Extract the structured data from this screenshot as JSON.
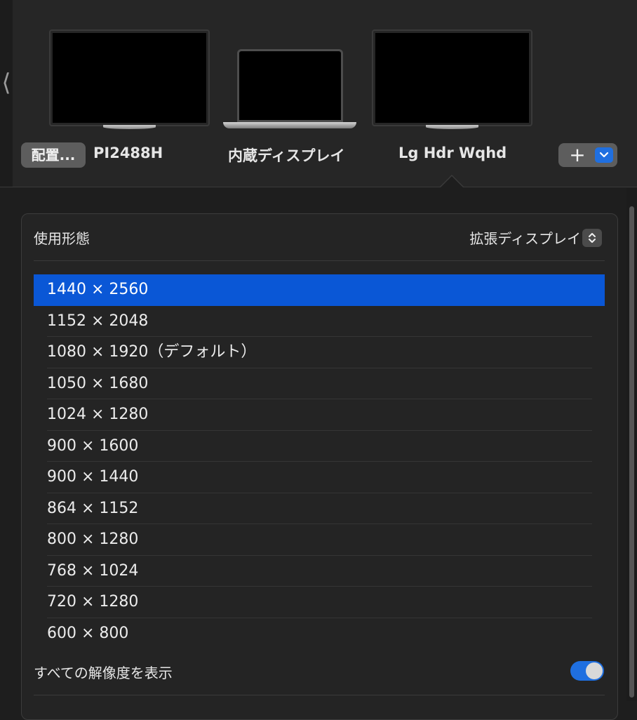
{
  "displays": [
    {
      "name": "PI2488H",
      "kind": "external-monitor"
    },
    {
      "name": "内蔵ディスプレイ",
      "kind": "laptop"
    },
    {
      "name": "Lg Hdr Wqhd",
      "kind": "external-monitor",
      "selected": true
    }
  ],
  "toolbar": {
    "arrange_label": "配置...",
    "add_label": "+"
  },
  "usage": {
    "label": "使用形態",
    "value": "拡張ディスプレイ"
  },
  "resolutions": [
    "1440 × 2560",
    "1152 × 2048",
    "1080 × 1920（デフォルト）",
    "1050 × 1680",
    "1024 × 1280",
    "900 × 1600",
    "900 × 1440",
    "864 × 1152",
    "800 × 1280",
    "768 × 1024",
    "720 × 1280",
    "600 × 800"
  ],
  "selected_resolution": "1440 × 2560",
  "show_all": {
    "label": "すべての解像度を表示",
    "enabled": true
  },
  "colors": {
    "accent": "#0a57d6",
    "toggle_on": "#1f6fe0",
    "background": "#1e1e1e"
  }
}
